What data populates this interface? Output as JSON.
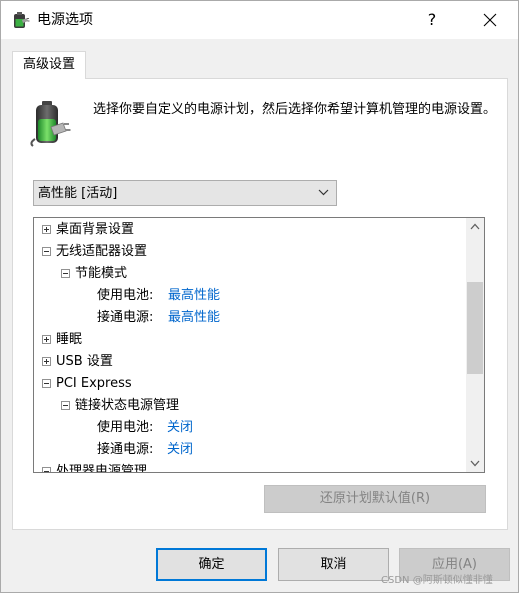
{
  "window": {
    "title": "电源选项",
    "help_label": "?"
  },
  "tabs": [
    {
      "label": "高级设置"
    }
  ],
  "description": "选择你要自定义的电源计划，然后选择你希望计算机管理的电源设置。",
  "plan": {
    "selected": "高性能 [活动]"
  },
  "tree": [
    {
      "label": "桌面背景设置",
      "expanded": false
    },
    {
      "label": "无线适配器设置",
      "expanded": true
    },
    {
      "label": "节能模式",
      "expanded": true
    },
    {
      "key": "使用电池:",
      "value": "最高性能"
    },
    {
      "key": "接通电源:",
      "value": "最高性能"
    },
    {
      "label": "睡眠",
      "expanded": false
    },
    {
      "label": "USB 设置",
      "expanded": false
    },
    {
      "label": "PCI Express",
      "expanded": true
    },
    {
      "label": "链接状态电源管理",
      "expanded": true
    },
    {
      "key": "使用电池:",
      "value": "关闭"
    },
    {
      "key": "接通电源:",
      "value": "关闭"
    },
    {
      "label": "处理器电源管理",
      "expanded": true
    }
  ],
  "buttons": {
    "restore_defaults": "还原计划默认值(R)",
    "ok": "确定",
    "cancel": "取消",
    "apply": "应用(A)"
  },
  "watermark": "CSDN @阿斯顿似懂非懂",
  "colors": {
    "link": "#0066cc",
    "focus_border": "#0078d7",
    "disabled_text": "#838383"
  },
  "icons": {
    "title": "power-options-icon",
    "header": "battery-plug-icon"
  }
}
